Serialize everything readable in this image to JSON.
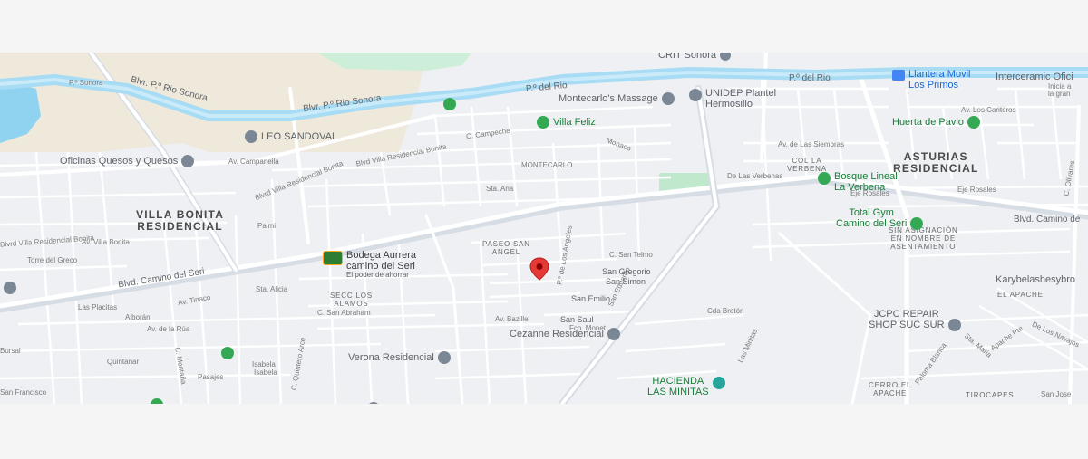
{
  "map": {
    "colors": {
      "background": "#eef0f3",
      "road": "#ffffff",
      "major_road": "#d7dde5",
      "river": "#a8dcf5",
      "park": "#cdeed9",
      "sand": "#efe9dc",
      "water": "#8fd3f1",
      "selected_pin": "#e53935"
    },
    "areas": [
      {
        "key": "villa_bonita",
        "text": "VILLA BONITA\nRESIDENCIAL"
      },
      {
        "key": "asturias",
        "text": "ASTURIAS\nRESIDENCIAL"
      }
    ],
    "small_areas": [
      {
        "key": "paseo_san_angel",
        "text": "PASEO SAN\nANGEL"
      },
      {
        "key": "secc_los_alamos",
        "text": "SECC LOS\nALAMOS"
      },
      {
        "key": "col_la_verbena",
        "text": "COL LA\nVERBENA"
      },
      {
        "key": "sin_asignacion",
        "text": "SIN ASIGNACIÓN\nEN NOMBRE DE\nASENTAMIENTO"
      },
      {
        "key": "el_apache",
        "text": "EL APACHE"
      },
      {
        "key": "cerro_el_apache",
        "text": "CERRO EL\nAPACHE"
      },
      {
        "key": "tirocapes",
        "text": "TIROCAPES"
      }
    ],
    "pois": [
      {
        "key": "leo_sandoval",
        "text": "LEO SANDOVAL",
        "icon": "place-pin-icon"
      },
      {
        "key": "oficinas_quesos",
        "text": "Oficinas Quesos y Quesos",
        "icon": "place-pin-icon"
      },
      {
        "key": "montecarlos",
        "text": "Montecarlo's Massage",
        "icon": "place-pin-icon"
      },
      {
        "key": "unidep",
        "text": "UNIDEP Plantel\nHermosillo",
        "icon": "school-icon"
      },
      {
        "key": "cri_sonora",
        "text": "CRIT Sonora",
        "icon": "place-pin-icon"
      },
      {
        "key": "cezanne",
        "text": "Cezanne Residencial",
        "icon": "place-pin-icon"
      },
      {
        "key": "verona",
        "text": "Verona Residencial",
        "icon": "place-pin-icon"
      },
      {
        "key": "jcpc",
        "text": "JCPC REPAIR\nSHOP SUC SUR",
        "icon": "place-pin-icon"
      },
      {
        "key": "karybel",
        "text": "Karybelashesybro",
        "icon": "place-pin-icon"
      },
      {
        "key": "intercer",
        "text": "Interceramic Ofici",
        "icon": "shop-icon"
      },
      {
        "key": "intercer_sub",
        "text": "Inicia a\nla gran",
        "icon": "none"
      }
    ],
    "green_pois": [
      {
        "key": "villa_feliz",
        "text": "Villa Feliz",
        "icon": "park-icon"
      },
      {
        "key": "huerta",
        "text": "Huerta de Pavlo",
        "icon": "park-icon"
      },
      {
        "key": "bosque",
        "text": "Bosque Lineal\nLa Verbena",
        "icon": "park-icon"
      },
      {
        "key": "total_gym",
        "text": "Total Gym\nCamino del Seri",
        "icon": "gym-icon"
      },
      {
        "key": "bodega",
        "text": "Bodega Aurrera\ncamino del Seri",
        "icon": "store-logo-icon"
      },
      {
        "key": "hacienda",
        "text": "HACIENDA\nLAS MINITAS",
        "icon": "park-icon"
      }
    ],
    "blue_pois": [
      {
        "key": "llantera",
        "text": "Llantera Movil\nLos Primos",
        "icon": "car-service-icon"
      }
    ],
    "bodega_sub": "El poder de ahorrar",
    "roads": [
      {
        "key": "blvr_rio_sonora_1",
        "text": "Blvr. P.º Rio Sonora"
      },
      {
        "key": "blvr_rio_sonora_2",
        "text": "Blvr. P.º Rio Sonora"
      },
      {
        "key": "po_del_rio_1",
        "text": "P.º del Rio"
      },
      {
        "key": "po_del_rio_2",
        "text": "P.º del Rio"
      },
      {
        "key": "blvd_camino_seri",
        "text": "Blvd. Camino del Seri"
      },
      {
        "key": "blvd_camino_seri_e",
        "text": "Blvd. Camino de"
      },
      {
        "key": "blvd_villa_res",
        "text": "Blvd Villa Residencial Bonita"
      },
      {
        "key": "blvd_villa_res_2",
        "text": "Blvrd Villa Residencial Bonita"
      },
      {
        "key": "blvrd_villa_res_w",
        "text": "Blvrd Villa Residencial Bonita"
      },
      {
        "key": "av_campanella",
        "text": "Av. Campanella"
      },
      {
        "key": "montecarlo",
        "text": "MONTECARLO"
      },
      {
        "key": "av_siembras",
        "text": "Av. de Las Siembras"
      },
      {
        "key": "verbenas",
        "text": "De Las Verbenas"
      }
    ],
    "streets": [
      {
        "key": "s1",
        "text": "P.º Sonora"
      },
      {
        "key": "s2",
        "text": "Sta. Ana"
      },
      {
        "key": "s3",
        "text": "Monaco"
      },
      {
        "key": "s4",
        "text": "Palmi"
      },
      {
        "key": "s5",
        "text": "Torre del Greco"
      },
      {
        "key": "s6",
        "text": "Eje Rosales"
      },
      {
        "key": "s7",
        "text": "Eje Rosales"
      },
      {
        "key": "s8",
        "text": "Sta. Alicia"
      },
      {
        "key": "s9",
        "text": "C. San Abraham"
      },
      {
        "key": "s10",
        "text": "Las Placitas"
      },
      {
        "key": "s11",
        "text": "Av. Tinaco"
      },
      {
        "key": "s12",
        "text": "Alborán"
      },
      {
        "key": "s13",
        "text": "Av. de la Rúa"
      },
      {
        "key": "s14",
        "text": "San Gregorio"
      },
      {
        "key": "s15",
        "text": "San Simon"
      },
      {
        "key": "s16",
        "text": "San Emilio"
      },
      {
        "key": "s17",
        "text": "San Saul"
      },
      {
        "key": "s18",
        "text": "Av. Bazille"
      },
      {
        "key": "s19",
        "text": "Cda Bretón"
      },
      {
        "key": "s20",
        "text": "Quintanar"
      },
      {
        "key": "s21",
        "text": "Pasajes"
      },
      {
        "key": "s22",
        "text": "Isabela"
      },
      {
        "key": "s23",
        "text": "Isabela"
      },
      {
        "key": "s24",
        "text": "C. Quintero Arce"
      },
      {
        "key": "s25",
        "text": "Las Minitas"
      },
      {
        "key": "s26",
        "text": "Paloma Blanca"
      },
      {
        "key": "s27",
        "text": "Apache Pte"
      },
      {
        "key": "s28",
        "text": "De Los Navajos"
      },
      {
        "key": "s29",
        "text": "San Jose"
      },
      {
        "key": "s30",
        "text": "C. Olivares"
      },
      {
        "key": "s31",
        "text": "Av. Los Canteros"
      },
      {
        "key": "s32",
        "text": "San Francisco"
      },
      {
        "key": "s33",
        "text": "Bursal"
      },
      {
        "key": "s34",
        "text": "C. San Telmo"
      },
      {
        "key": "s35",
        "text": "C. Campeche"
      },
      {
        "key": "s36",
        "text": "P.º de Los Angeles"
      },
      {
        "key": "s37",
        "text": "San Eduardo"
      },
      {
        "key": "s38",
        "text": "Sta. Maria"
      },
      {
        "key": "s39",
        "text": "Fco. Monet"
      },
      {
        "key": "s40",
        "text": "Av. Villa Bonita"
      },
      {
        "key": "s41",
        "text": "C. Montaña"
      }
    ]
  }
}
